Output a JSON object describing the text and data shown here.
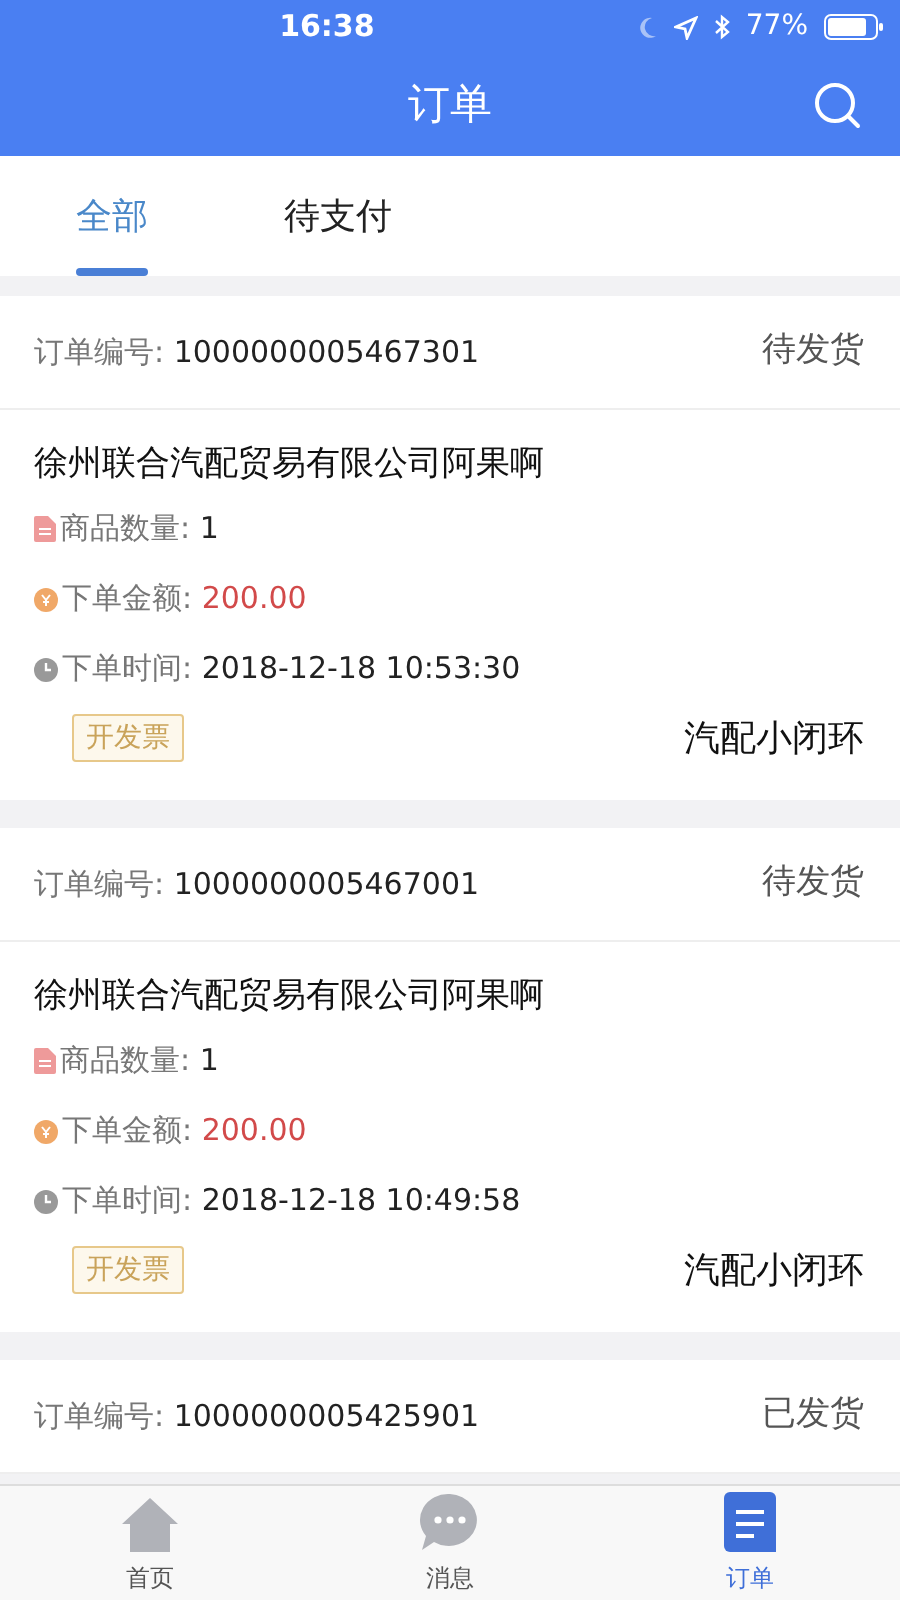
{
  "status_bar": {
    "time": "16:38",
    "battery": "77%"
  },
  "header": {
    "title": "订单"
  },
  "tabs": [
    {
      "label": "全部",
      "selected": true
    },
    {
      "label": "待支付",
      "selected": false
    }
  ],
  "orders": [
    {
      "number_label": "订单编号:",
      "number": "1000000005467301",
      "status": "待发货",
      "company": "徐州联合汽配贸易有限公司阿果啊",
      "quantity_label": "商品数量:",
      "quantity": "1",
      "amount_label": "下单金额:",
      "amount": "200.00",
      "time_label": "下单时间:",
      "time": "2018-12-18 10:53:30",
      "invoice_button": "开发票",
      "shop": "汽配小闭环"
    },
    {
      "number_label": "订单编号:",
      "number": "1000000005467001",
      "status": "待发货",
      "company": "徐州联合汽配贸易有限公司阿果啊",
      "quantity_label": "商品数量:",
      "quantity": "1",
      "amount_label": "下单金额:",
      "amount": "200.00",
      "time_label": "下单时间:",
      "time": "2018-12-18 10:49:58",
      "invoice_button": "开发票",
      "shop": "汽配小闭环"
    },
    {
      "number_label": "订单编号:",
      "number": "1000000005425901",
      "status": "已发货"
    }
  ],
  "tab_bar": [
    {
      "kind": "home",
      "label": "首页",
      "selected": false
    },
    {
      "kind": "message",
      "label": "消息",
      "selected": false
    },
    {
      "kind": "order",
      "label": "订单",
      "selected": true
    }
  ]
}
